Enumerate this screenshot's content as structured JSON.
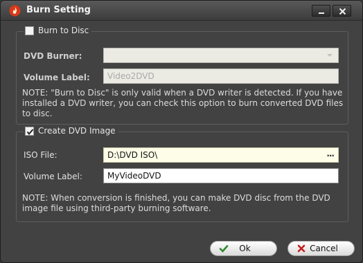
{
  "window": {
    "title": "Burn Setting"
  },
  "burn": {
    "checkbox_label": "Burn to Disc",
    "checked": false,
    "dvd_burner_label": "DVD Burner:",
    "dvd_burner_value": "",
    "volume_label": "Volume Label:",
    "volume_value": "Video2DVD",
    "note": "NOTE: \"Burn to Disc\" is only valid when a DVD writer is detected. If you have installed a DVD writer, you can check this option to burn converted DVD files to disc."
  },
  "image": {
    "checkbox_label": "Create DVD Image",
    "checked": true,
    "iso_label": "ISO File:",
    "iso_value": "D:\\DVD ISO\\",
    "browse_label": "...",
    "volume_label": "Volume Label:",
    "volume_value": "MyVideoDVD",
    "note": "NOTE: When conversion is finished, you can make DVD disc from the DVD image file using third-party burning software."
  },
  "buttons": {
    "ok": "Ok",
    "cancel": "Cancel"
  },
  "colors": {
    "ok_icon": "#2e8a2e",
    "cancel_icon": "#c41f1f",
    "app_icon": "#d8381a"
  },
  "icons": {
    "app": "flame-icon",
    "minimize": "minimize-icon",
    "close": "close-icon",
    "ok": "checkmark-icon",
    "cancel": "x-icon"
  }
}
